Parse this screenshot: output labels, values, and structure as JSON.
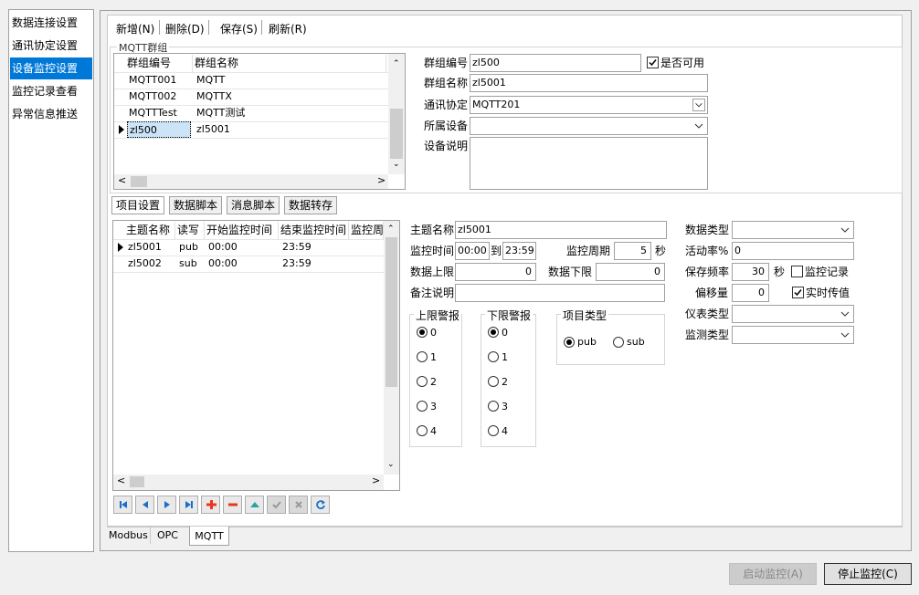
{
  "nav": {
    "items": [
      "数据连接设置",
      "通讯协定设置",
      "设备监控设置",
      "监控记录查看",
      "异常信息推送"
    ],
    "selected_index": 2
  },
  "toolbar": {
    "add": "新增(N)",
    "delete": "删除(D)",
    "save": "保存(S)",
    "refresh": "刷新(R)"
  },
  "group": {
    "title": "MQTT群组",
    "columns": [
      "群组编号",
      "群组名称"
    ],
    "rows": [
      {
        "id": "MQTT001",
        "name": "MQTT"
      },
      {
        "id": "MQTT002",
        "name": "MQTTX"
      },
      {
        "id": "MQTTTest",
        "name": "MQTT测试"
      },
      {
        "id": "zl500",
        "name": "zl5001"
      }
    ],
    "current_row": 3
  },
  "group_form": {
    "id_label": "群组编号",
    "id_value": "zl500",
    "enabled_label": "是否可用",
    "enabled": true,
    "name_label": "群组名称",
    "name_value": "zl5001",
    "protocol_label": "通讯协定",
    "protocol_value": "MQTT201",
    "device_label": "所属设备",
    "device_value": "",
    "desc_label": "设备说明",
    "desc_value": ""
  },
  "subtabs": [
    "项目设置",
    "数据脚本",
    "消息脚本",
    "数据转存"
  ],
  "subtab_active": 0,
  "items": {
    "columns": [
      "主题名称",
      "读写",
      "开始监控时间",
      "结束监控时间",
      "监控周"
    ],
    "rows": [
      {
        "topic": "zl5001",
        "rw": "pub",
        "start": "00:00",
        "end": "23:59"
      },
      {
        "topic": "zl5002",
        "rw": "sub",
        "start": "00:00",
        "end": "23:59"
      }
    ],
    "current_row": 0
  },
  "item_form": {
    "topic_label": "主题名称",
    "topic_value": "zl5001",
    "time_label": "监控时间",
    "time_from": "00:00",
    "time_to_label": "到",
    "time_to": "23:59",
    "period_label": "监控周期",
    "period_value": "5",
    "period_unit": "秒",
    "upper_label": "数据上限",
    "upper_value": "0",
    "lower_label": "数据下限",
    "lower_value": "0",
    "note_label": "备注说明",
    "note_value": "",
    "datatype_label": "数据类型",
    "datatype_value": "",
    "active_label": "活动率%",
    "active_value": "0",
    "savefreq_label": "保存频率",
    "savefreq_value": "30",
    "savefreq_unit": "秒",
    "record_label": "监控记录",
    "record_checked": false,
    "offset_label": "偏移量",
    "offset_value": "0",
    "realtime_label": "实时传值",
    "realtime_checked": true,
    "meter_label": "仪表类型",
    "meter_value": "",
    "detect_label": "监测类型",
    "detect_value": "",
    "upper_alarm_title": "上限警报",
    "lower_alarm_title": "下限警报",
    "alarm_options": [
      "0",
      "1",
      "2",
      "3",
      "4"
    ],
    "upper_alarm_selected": 0,
    "lower_alarm_selected": 0,
    "itemtype_title": "项目类型",
    "itemtype_options": [
      "pub",
      "sub"
    ],
    "itemtype_selected": 0
  },
  "bottom_tabs": [
    "Modbus",
    "OPC",
    "MQTT"
  ],
  "bottom_tab_active": 2,
  "buttons": {
    "start": "启动监控(A)",
    "stop": "停止监控(C)"
  },
  "colors": {
    "selection": "#0078d7",
    "navigator_blue": "#1c6fc9",
    "add_red": "#e8361f"
  }
}
